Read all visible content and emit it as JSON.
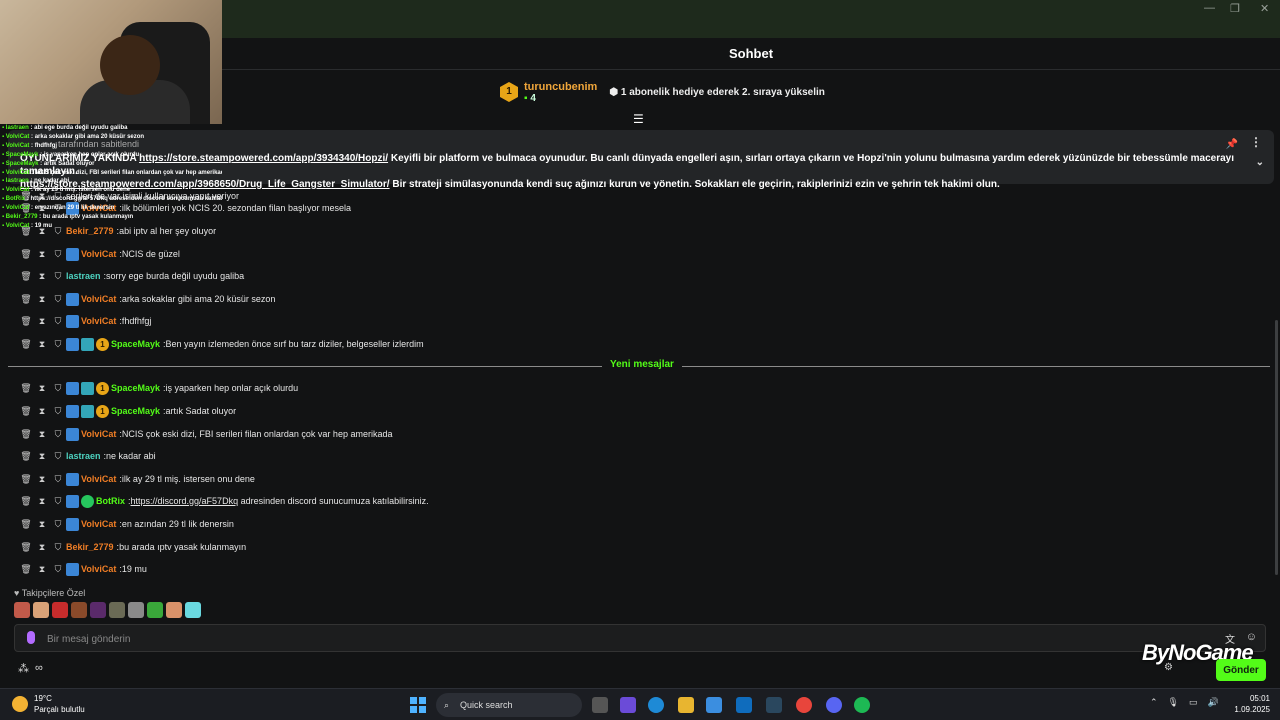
{
  "window": {
    "controls": [
      "—",
      "❐",
      "✕"
    ]
  },
  "chat": {
    "title": "Sohbet"
  },
  "gift": {
    "rank": "1",
    "user": "turuncubenim",
    "count": "4",
    "text": "1 abonelik hediye ederek 2. sıraya yükselin"
  },
  "pinned": {
    "header": "tarafından sabitlendi",
    "line1_prefix": "OYUNLARIMIZ YAKINDA",
    "link1": "https://store.steampowered.com/app/3934340/Hopzi/",
    "line1_rest": " Keyifli bir platform ve bulmaca oyunudur. Bu canlı dünyada engelleri aşın, sırları ortaya çıkarın ve Hopzi'nin yolunu bulmasına yardım ederek yüzünüzde bir tebessümle macerayı tamamlayın.",
    "link2": "https://store.steampowered.com/app/3968650/Drug_Life_Gangster_Simulator/",
    "line2_rest": " Bir strateji simülasyonunda kendi suç ağınızı kurun ve yönetin. Sokakları ele geçirin, rakiplerinizi ezin ve şehrin tek hakimi olun."
  },
  "old_messages": [
    {
      "user": "",
      "text": "serileri de var isimli kullanıcıya yanıt veriyor"
    },
    {
      "user": "VolviCat",
      "text": "ilk bölümleri yok NCIS 20. sezondan filan başlıyor mesela"
    },
    {
      "user": "Bekir_2779",
      "text": "abi iptv al her şey oluyor"
    },
    {
      "user": "VolviCat",
      "text": "NCIS de güzel"
    },
    {
      "user": "lastraen",
      "text": "sorry ege burda değil uyudu galiba"
    },
    {
      "user": "VolviCat",
      "text": "arka sokaklar gibi ama 20 küsür sezon"
    },
    {
      "user": "VolviCat",
      "text": "fhdfhfgj"
    },
    {
      "user": "SpaceMayk",
      "text": "Ben yayın izlemeden önce sırf bu tarz diziler, belgeseller izlerdim"
    }
  ],
  "divider_label": "Yeni mesajlar",
  "new_messages": [
    {
      "user": "SpaceMayk",
      "text": "iş yaparken hep onlar açık olurdu"
    },
    {
      "user": "SpaceMayk",
      "text": "artık Sadat oluyor"
    },
    {
      "user": "VolviCat",
      "text": "NCIS çok eski dizi, FBI serileri filan onlardan çok var hep amerikada"
    },
    {
      "user": "lastraen",
      "text": "ne kadar abi"
    },
    {
      "user": "VolviCat",
      "text": "ilk ay 29 tl miş. istersen onu dene"
    },
    {
      "user": "BotRix",
      "link": "https://discord.gg/aF57Dkq",
      "text": " adresinden discord sunucumuza katılabilirsiniz."
    },
    {
      "user": "VolviCat",
      "text": "en azından 29 tl lik denersin"
    },
    {
      "user": "Bekir_2779",
      "text": "bu arada ıptv yasak kulanmayın"
    },
    {
      "user": "VolviCat",
      "text": "19 mu"
    }
  ],
  "overlay": [
    {
      "user": "lastraen",
      "text": "abi ege burda değil uyudu galiba"
    },
    {
      "user": "VolviCat",
      "text": "arka sokaklar gibi ama 20 küsür sezon"
    },
    {
      "user": "VolviCat",
      "text": "fhdfhfgj"
    },
    {
      "user": "SpaceMayk",
      "text": "iş yaparken hep onlar açık olurdu"
    },
    {
      "user": "SpaceMayk",
      "text": "artık Sadat oluyor"
    },
    {
      "user": "VolviCat",
      "text": "NCIS çok eski dizi, FBI serileri filan onlardan çok var hep amerikada"
    },
    {
      "user": "lastraen",
      "text": "ne kadar abi"
    },
    {
      "user": "VolviCat",
      "text": "ilk ay 29 tl miş. istersen onu dene"
    },
    {
      "user": "BotRix",
      "text": "https://discord.gg/aF57Dkq adresinden discord sunucumuza katılabilirsiniz."
    },
    {
      "user": "VolviCat",
      "text": "en azından 29 tl lik denersin"
    },
    {
      "user": "Bekir_2779",
      "text": "bu arada ıptv yasak kulanmayın"
    },
    {
      "user": "VolviCat",
      "text": "19 mu"
    }
  ],
  "followers_label": "Takipçilere Özel",
  "input": {
    "placeholder": "Bir mesaj gönderin"
  },
  "send_label": "Gönder",
  "watermark": "ByNoGame",
  "taskbar": {
    "temp": "19°C",
    "weather": "Parçalı bulutlu",
    "search": "Quick search",
    "time": "05:01",
    "date": "1.09.2025"
  }
}
